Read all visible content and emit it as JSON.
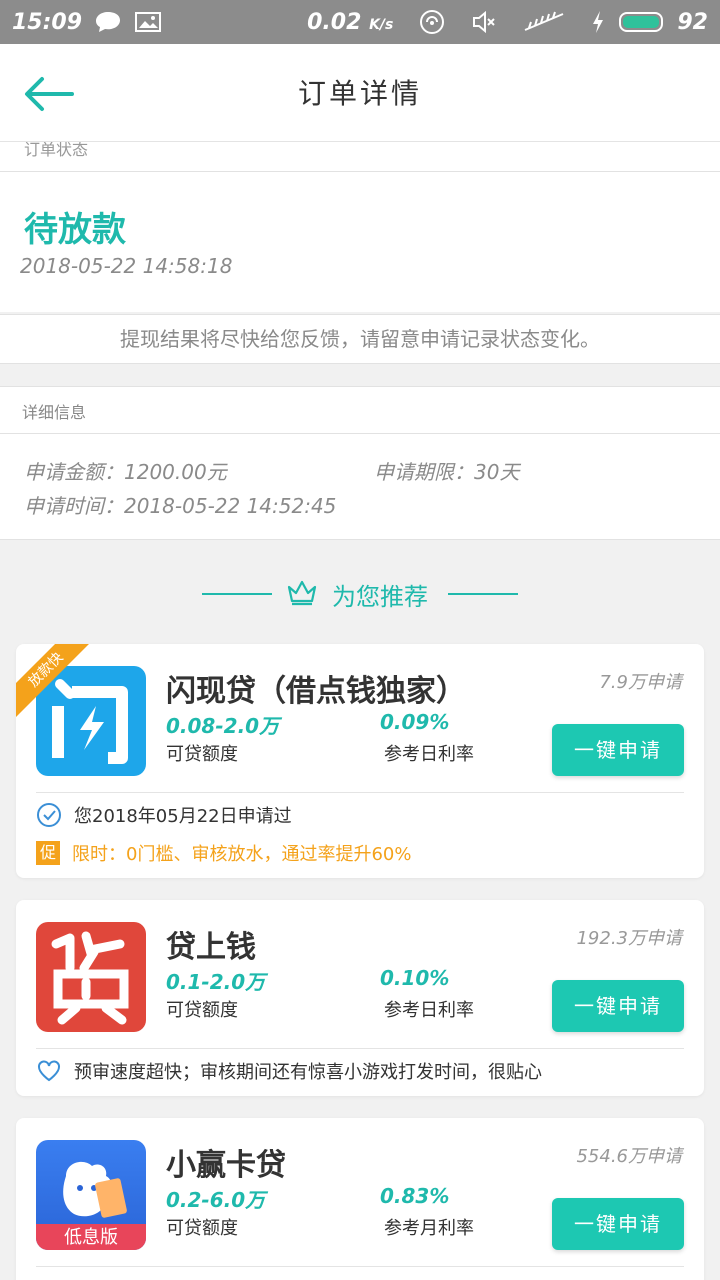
{
  "status_bar": {
    "time": "15:09",
    "speed": "0.02",
    "speed_unit": "K/s",
    "battery": "92"
  },
  "header": {
    "title": "订单详情"
  },
  "order": {
    "section_label": "订单状态",
    "status": "待放款",
    "datetime": "2018-05-22 14:58:18",
    "note": "提现结果将尽快给您反馈，请留意申请记录状态变化。"
  },
  "detail": {
    "section_label": "详细信息",
    "amount": "申请金额：1200.00元",
    "term": "申请期限：30天",
    "apply_time": "申请时间：2018-05-22 14:52:45"
  },
  "recommend": {
    "title": "为您推荐"
  },
  "products": [
    {
      "badge": "放款快",
      "name": "闪现贷（借点钱独家）",
      "count": "7.9万申请",
      "range": "0.08-2.0万",
      "range_label": "可贷额度",
      "rate": "0.09%",
      "rate_label": "参考日利率",
      "button": "一键申请",
      "applied": "您2018年05月22日申请过",
      "promo_tag": "促",
      "promo": "限时：0门槛、审核放水，通过率提升60%"
    },
    {
      "name": "贷上钱",
      "count": "192.3万申请",
      "range": "0.1-2.0万",
      "range_label": "可贷额度",
      "rate": "0.10%",
      "rate_label": "参考日利率",
      "button": "一键申请",
      "feature": "预审速度超快；审核期间还有惊喜小游戏打发时间，很贴心"
    },
    {
      "name": "小赢卡贷",
      "count": "554.6万申请",
      "range": "0.2-6.0万",
      "range_label": "可贷额度",
      "rate": "0.83%",
      "rate_label": "参考月利率",
      "button": "一键申请",
      "logo_text": "低息版"
    }
  ],
  "colors": {
    "accent": "#1fb9ac",
    "button": "#1dc8b2",
    "promo": "#f4a21b",
    "status_bar": "#8c8c8c"
  }
}
